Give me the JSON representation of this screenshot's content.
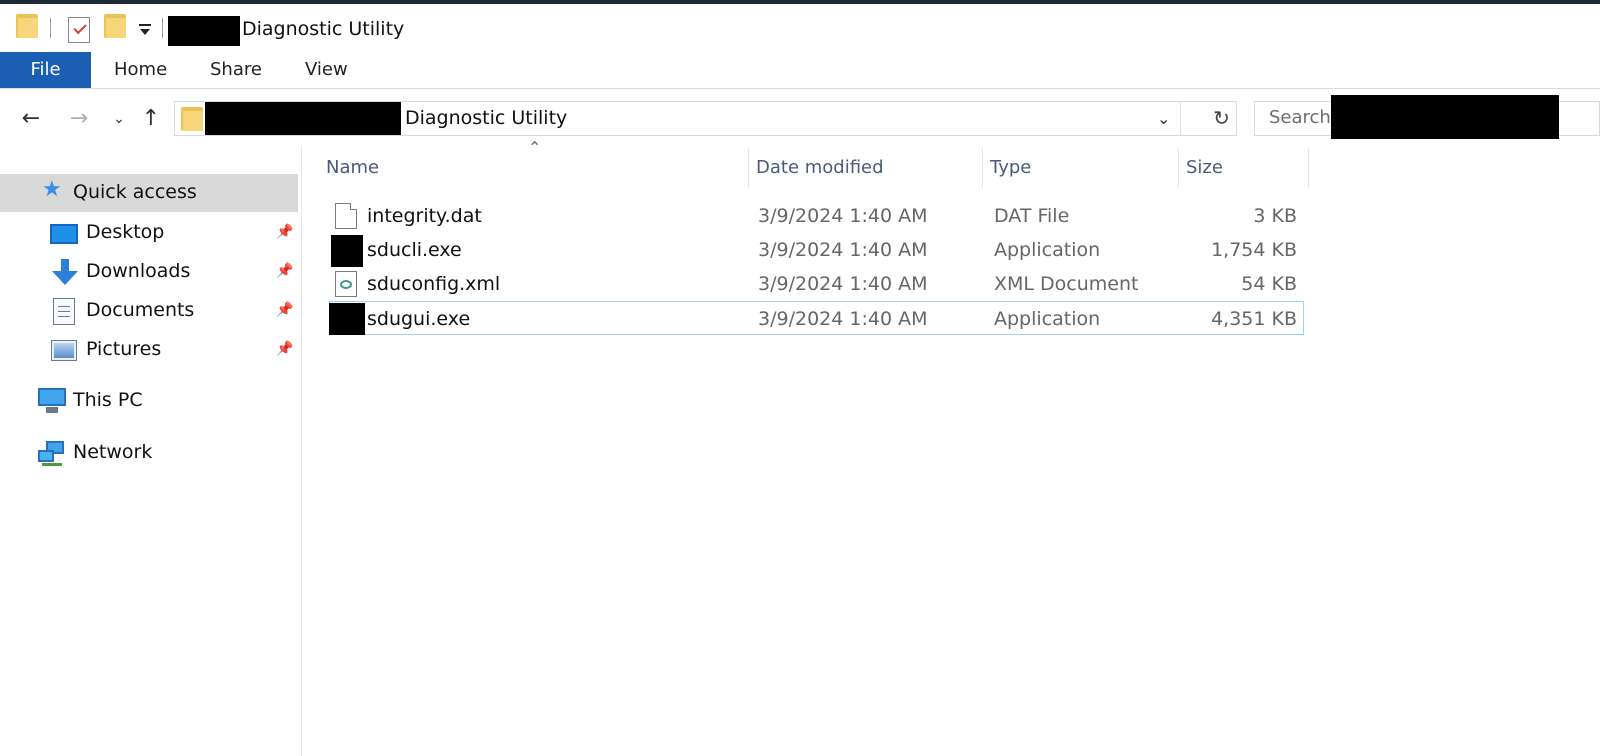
{
  "window": {
    "title": "Diagnostic Utility"
  },
  "quick_access_toolbar": {
    "items": [
      "folder-icon",
      "properties-icon",
      "new-folder-icon",
      "customize-dropdown"
    ]
  },
  "ribbon": {
    "tabs": [
      {
        "label": "File",
        "active": true
      },
      {
        "label": "Home"
      },
      {
        "label": "Share"
      },
      {
        "label": "View"
      }
    ]
  },
  "address_bar": {
    "path_tail": "Diagnostic Utility"
  },
  "search": {
    "placeholder": "Search"
  },
  "nav_pane": {
    "quick_access": "Quick access",
    "items": [
      {
        "label": "Desktop",
        "pinned": true
      },
      {
        "label": "Downloads",
        "pinned": true
      },
      {
        "label": "Documents",
        "pinned": true
      },
      {
        "label": "Pictures",
        "pinned": true
      }
    ],
    "this_pc": "This PC",
    "network": "Network"
  },
  "file_list": {
    "columns": [
      "Name",
      "Date modified",
      "Type",
      "Size"
    ],
    "rows": [
      {
        "name": "integrity.dat",
        "date": "3/9/2024 1:40 AM",
        "type": "DAT File",
        "size": "3 KB"
      },
      {
        "name": "sducli.exe",
        "date": "3/9/2024 1:40 AM",
        "type": "Application",
        "size": "1,754 KB"
      },
      {
        "name": "sduconfig.xml",
        "date": "3/9/2024 1:40 AM",
        "type": "XML Document",
        "size": "54 KB"
      },
      {
        "name": "sdugui.exe",
        "date": "3/9/2024 1:40 AM",
        "type": "Application",
        "size": "4,351 KB",
        "selected": true
      }
    ]
  },
  "colors": {
    "file_tab": "#1a5fb4",
    "selection_border": "#99d1ff",
    "nav_selected": "#d9d9d9",
    "header_text": "#4a5a7a"
  }
}
